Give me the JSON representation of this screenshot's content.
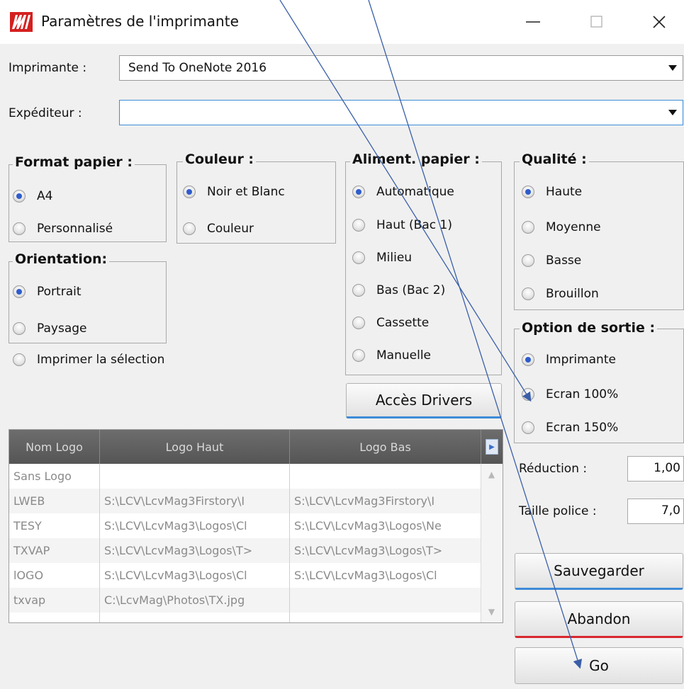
{
  "window": {
    "title": "Paramètres de l'imprimante"
  },
  "imprimante": {
    "label": "Imprimante :",
    "value": "Send To OneNote 2016"
  },
  "expediteur": {
    "label": "Expéditeur :",
    "value": ""
  },
  "format_papier": {
    "title": "Format papier :",
    "options": [
      "A4",
      "Personnalisé"
    ],
    "selected": "A4"
  },
  "couleur": {
    "title": "Couleur :",
    "options": [
      "Noir et Blanc",
      "Couleur"
    ],
    "selected": "Noir et Blanc"
  },
  "aliment_papier": {
    "title": "Aliment. papier :",
    "options": [
      "Automatique",
      "Haut (Bac 1)",
      "Milieu",
      "Bas (Bac 2)",
      "Cassette",
      "Manuelle"
    ],
    "selected": "Automatique"
  },
  "qualite": {
    "title": "Qualité :",
    "options": [
      "Haute",
      "Moyenne",
      "Basse",
      "Brouillon"
    ],
    "selected": "Haute"
  },
  "orientation": {
    "title": "Orientation:",
    "options": [
      "Portrait",
      "Paysage"
    ],
    "selected": "Portrait"
  },
  "imprimer_selection": {
    "label": "Imprimer la sélection",
    "checked": false
  },
  "option_sortie": {
    "title": "Option de sortie :",
    "options": [
      "Imprimante",
      "Ecran 100%",
      "Ecran 150%"
    ],
    "selected": "Imprimante"
  },
  "buttons": {
    "acces_drivers": "Accès Drivers",
    "sauvegarder": "Sauvegarder",
    "abandon": "Abandon",
    "go": "Go"
  },
  "reduction": {
    "label": "Réduction :",
    "value": "1,00"
  },
  "taille_police": {
    "label": "Taille police :",
    "value": "7,0"
  },
  "logo_table": {
    "columns": [
      "Nom Logo",
      "Logo Haut",
      "Logo Bas"
    ],
    "rows": [
      [
        "Sans Logo",
        "",
        ""
      ],
      [
        "LWEB",
        "S:\\LCV\\LcvMag3Firstory\\I",
        "S:\\LCV\\LcvMag3Firstory\\I"
      ],
      [
        "TESY",
        "S:\\LCV\\LcvMag3\\Logos\\Cl",
        "S:\\LCV\\LcvMag3\\Logos\\Ne"
      ],
      [
        "TXVAP",
        "S:\\LCV\\LcvMag3\\Logos\\T>",
        "S:\\LCV\\LcvMag3\\Logos\\T>"
      ],
      [
        "lOGO",
        "S:\\LCV\\LcvMag3\\Logos\\Cl",
        "S:\\LCV\\LcvMag3\\Logos\\Cl"
      ],
      [
        "txvap",
        "C:\\LcvMag\\Photos\\TX.jpg",
        ""
      ]
    ]
  },
  "colors": {
    "accent_blue": "#3d8bd8",
    "accent_red": "#d8282e",
    "radio_dot": "#2e5ccc",
    "annotation": "#3a5fa8"
  }
}
